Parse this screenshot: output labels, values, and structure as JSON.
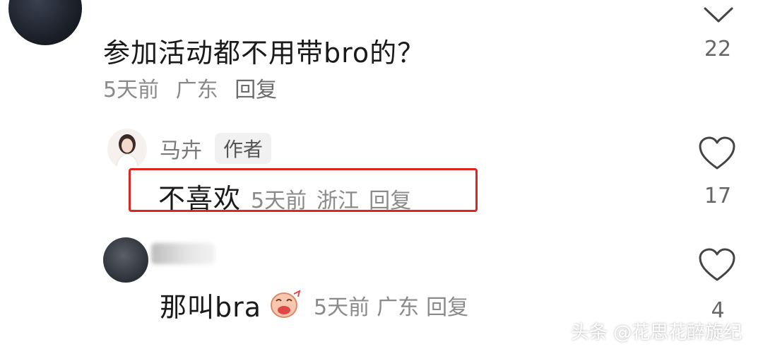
{
  "comment1": {
    "text": "参加活动都不用带bro的？",
    "time": "5天前",
    "location": "广东",
    "reply_label": "回复",
    "like_count": "22"
  },
  "comment2": {
    "author_name": "马卉",
    "author_badge": "作者",
    "text": "不喜欢",
    "time": "5天前",
    "location": "浙江",
    "reply_label": "回复",
    "like_count": "17"
  },
  "comment3": {
    "text": "那叫bra",
    "time": "5天前",
    "location": "广东",
    "reply_label": "回复",
    "like_count": "4"
  },
  "watermark": "头条 @花思花醉旋纪",
  "colors": {
    "highlight": "#e02424",
    "meta": "#8a8a8a"
  }
}
